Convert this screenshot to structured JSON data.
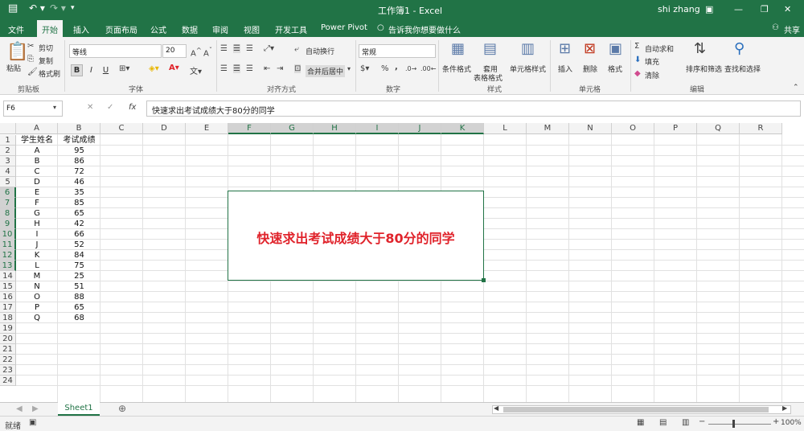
{
  "window": {
    "title": "工作簿1 - Excel",
    "user": "shi zhang"
  },
  "tabs": [
    "文件",
    "开始",
    "插入",
    "页面布局",
    "公式",
    "数据",
    "审阅",
    "视图",
    "开发工具",
    "Power Pivot"
  ],
  "tell_me": "告诉我你想要做什么",
  "share": "共享",
  "clipboard": {
    "paste": "粘贴",
    "cut": "剪切",
    "copy": "复制",
    "format_painter": "格式刷",
    "group": "剪贴板"
  },
  "font": {
    "name": "等线",
    "size": "20",
    "group": "字体",
    "bold": "B",
    "italic": "I",
    "underline": "U"
  },
  "alignment": {
    "wrap": "自动换行",
    "merge": "合并后居中",
    "group": "对齐方式"
  },
  "number": {
    "format": "常规",
    "percent": "%",
    "comma": ",",
    "group": "数字"
  },
  "styles": {
    "conditional": "条件格式",
    "table1": "套用",
    "table2": "表格格式",
    "cell_styles": "单元格样式",
    "group": "样式"
  },
  "cells": {
    "insert": "插入",
    "delete": "删除",
    "format": "格式",
    "group": "单元格"
  },
  "editing": {
    "autosum": "自动求和",
    "fill": "填充",
    "clear": "清除",
    "sort": "排序和筛选",
    "find": "查找和选择",
    "group": "编辑"
  },
  "formula_bar": {
    "name_box": "F6",
    "fx": "fx",
    "content": "快速求出考试成绩大于80分的同学"
  },
  "columns": [
    "A",
    "B",
    "C",
    "D",
    "E",
    "F",
    "G",
    "H",
    "I",
    "J",
    "K",
    "L",
    "M",
    "N",
    "O",
    "P",
    "Q",
    "R"
  ],
  "rows": [
    "1",
    "2",
    "3",
    "4",
    "5",
    "6",
    "7",
    "8",
    "9",
    "10",
    "11",
    "12",
    "13",
    "14",
    "15",
    "16",
    "17",
    "18",
    "19",
    "20",
    "21",
    "22",
    "23",
    "24"
  ],
  "table": {
    "header": [
      "学生姓名",
      "考试成绩"
    ],
    "data": [
      [
        "A",
        "95"
      ],
      [
        "B",
        "86"
      ],
      [
        "C",
        "72"
      ],
      [
        "D",
        "46"
      ],
      [
        "E",
        "35"
      ],
      [
        "F",
        "85"
      ],
      [
        "G",
        "65"
      ],
      [
        "H",
        "42"
      ],
      [
        "I",
        "66"
      ],
      [
        "J",
        "52"
      ],
      [
        "K",
        "84"
      ],
      [
        "L",
        "75"
      ],
      [
        "M",
        "25"
      ],
      [
        "N",
        "51"
      ],
      [
        "O",
        "88"
      ],
      [
        "P",
        "65"
      ],
      [
        "Q",
        "68"
      ]
    ]
  },
  "textbox": "快速求出考试成绩大于80分的同学",
  "sheet": {
    "name": "Sheet1",
    "add": "⊕"
  },
  "status": {
    "mode": "就绪",
    "zoom": "100%"
  },
  "colors": {
    "excel_green": "#217346",
    "textbox_text": "#e0232b"
  }
}
